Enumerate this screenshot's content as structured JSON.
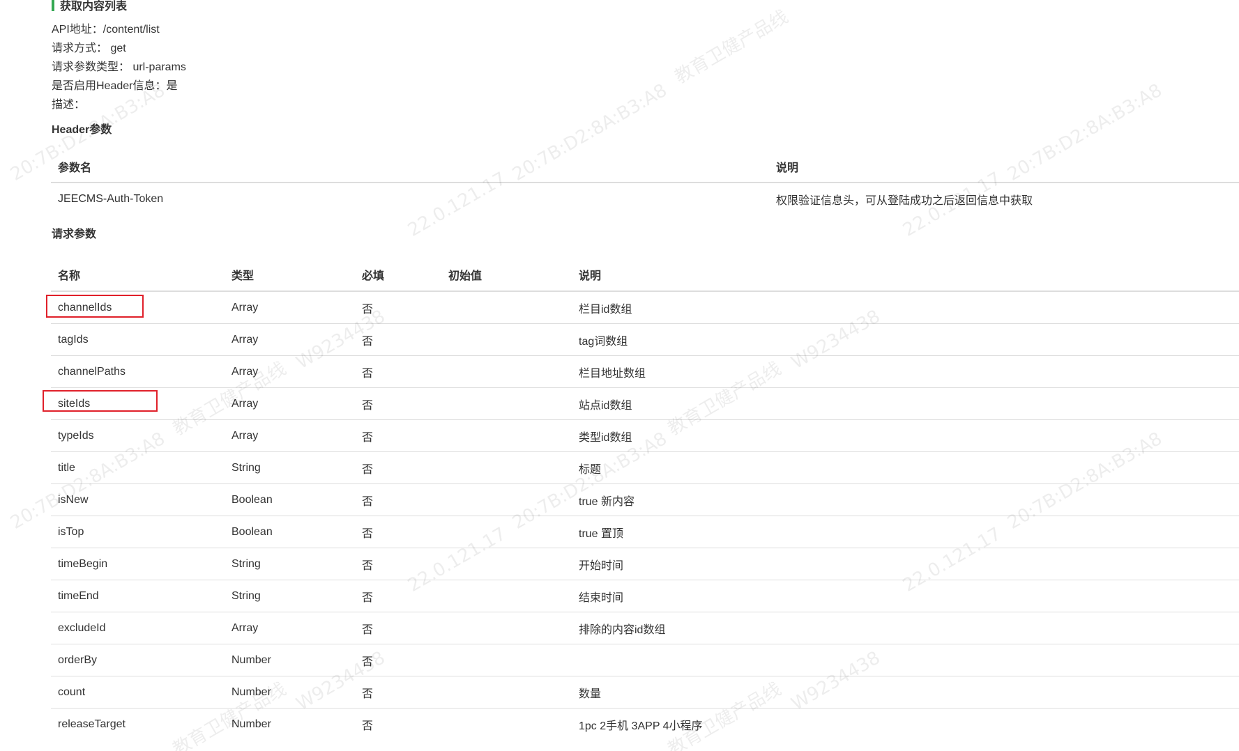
{
  "section": {
    "title": "获取内容列表"
  },
  "meta": {
    "api": "API地址：/content/list",
    "method": "请求方式： get",
    "param_type": "请求参数类型： url-params",
    "header_enabled": "是否启用Header信息：是",
    "description": "描述："
  },
  "header_params": {
    "heading": "Header参数",
    "columns": [
      "参数名",
      "说明"
    ],
    "rows": [
      {
        "name": "JEECMS-Auth-Token",
        "desc": "权限验证信息头，可从登陆成功之后返回信息中获取"
      }
    ]
  },
  "request_params": {
    "heading": "请求参数",
    "columns": [
      "名称",
      "类型",
      "必填",
      "初始值",
      "说明"
    ],
    "rows": [
      {
        "name": "channelIds",
        "type": "Array",
        "required": "否",
        "default": "",
        "desc": "栏目id数组"
      },
      {
        "name": "tagIds",
        "type": "Array",
        "required": "否",
        "default": "",
        "desc": "tag词数组"
      },
      {
        "name": "channelPaths",
        "type": "Array",
        "required": "否",
        "default": "",
        "desc": "栏目地址数组"
      },
      {
        "name": "siteIds",
        "type": "Array",
        "required": "否",
        "default": "",
        "desc": "站点id数组"
      },
      {
        "name": "typeIds",
        "type": "Array",
        "required": "否",
        "default": "",
        "desc": "类型id数组"
      },
      {
        "name": "title",
        "type": "String",
        "required": "否",
        "default": "",
        "desc": "标题"
      },
      {
        "name": "isNew",
        "type": "Boolean",
        "required": "否",
        "default": "",
        "desc": "true 新内容"
      },
      {
        "name": "isTop",
        "type": "Boolean",
        "required": "否",
        "default": "",
        "desc": "true 置顶"
      },
      {
        "name": "timeBegin",
        "type": "String",
        "required": "否",
        "default": "",
        "desc": "开始时间"
      },
      {
        "name": "timeEnd",
        "type": "String",
        "required": "否",
        "default": "",
        "desc": "结束时间"
      },
      {
        "name": "excludeId",
        "type": "Array",
        "required": "否",
        "default": "",
        "desc": "排除的内容id数组"
      },
      {
        "name": "orderBy",
        "type": "Number",
        "required": "否",
        "default": "",
        "desc": ""
      },
      {
        "name": "count",
        "type": "Number",
        "required": "否",
        "default": "",
        "desc": "数量"
      },
      {
        "name": "releaseTarget",
        "type": "Number",
        "required": "否",
        "default": "",
        "desc": "1pc 2手机 3APP 4小程序"
      }
    ]
  },
  "watermark": {
    "text_a": "20:7B:D2:8A:B3:A8",
    "text_b": "22.0.121.17",
    "text_c": "教育卫健产品线",
    "text_d": "W9234438"
  },
  "colors": {
    "accent_bar": "#34a853",
    "highlight": "#e0202a",
    "border": "#dddddd"
  }
}
